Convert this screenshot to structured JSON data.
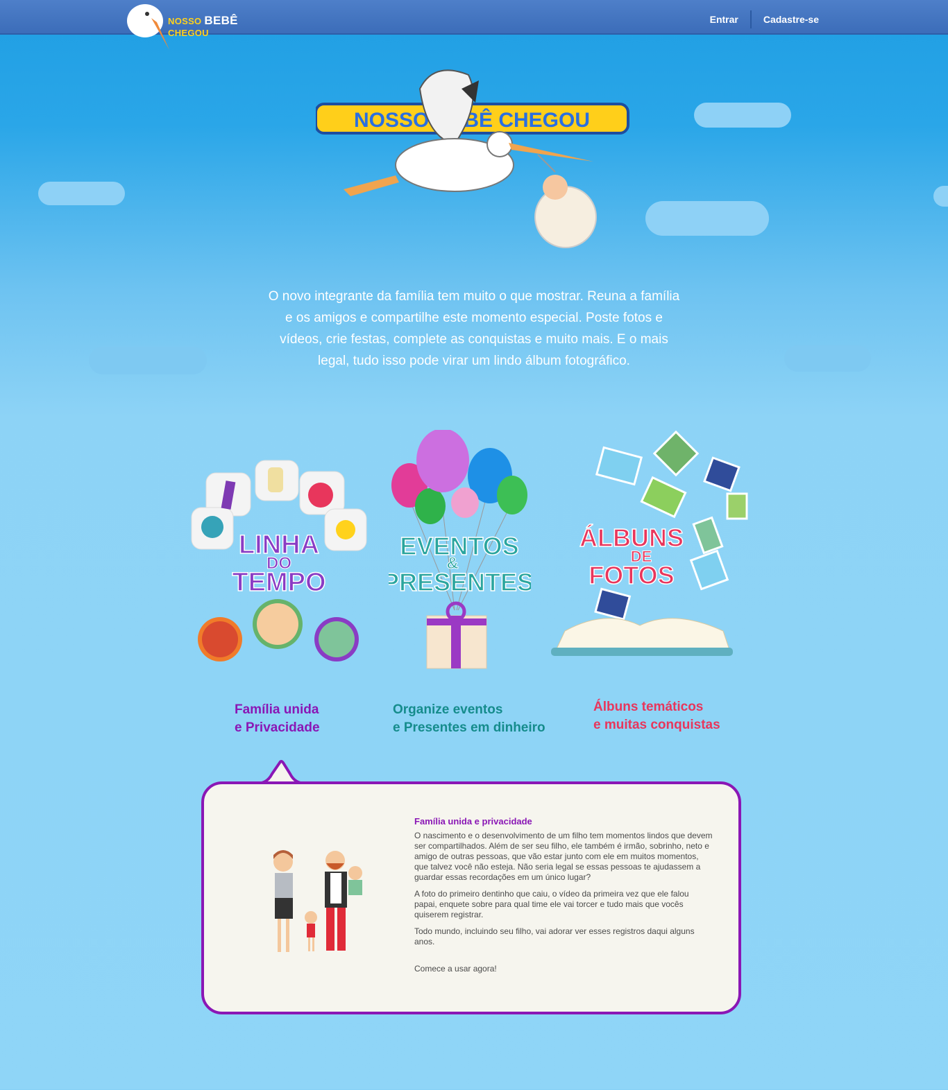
{
  "header": {
    "logo_small1": "NOSSO",
    "logo_big": "BEBÊ",
    "logo_small2": "CHEGOU",
    "nav_login": "Entrar",
    "nav_signup": "Cadastre-se"
  },
  "hero": {
    "banner_text": "NOSSO BEBÊ CHEGOU"
  },
  "intro": {
    "text": "O novo integrante da família tem muito o que mostrar. Reuna a família e os amigos e compartilhe este momento especial. Poste fotos e vídeos, crie festas, complete as conquistas e muito mais. E o mais legal, tudo isso pode virar um lindo álbum fotográfico."
  },
  "features": [
    {
      "title_line1": "LINHA",
      "title_line2": "DO",
      "title_line3": "TEMPO",
      "caption_line1": "Família unida",
      "caption_line2": "e  Privacidade",
      "color": "#8a17b5"
    },
    {
      "title_line1": "EVENTOS",
      "title_line2": "&",
      "title_line3": "PRESENTES",
      "caption_line1": "Organize eventos",
      "caption_line2": "e Presentes em dinheiro",
      "color": "#158c8c"
    },
    {
      "title_line1": "ÁLBUNS",
      "title_line2": "DE",
      "title_line3": "FOTOS",
      "caption_line1": "Álbuns temáticos",
      "caption_line2": "e muitas conquistas",
      "color": "#e8365c"
    }
  ],
  "panel": {
    "heading": "Família unida e privacidade",
    "p1": "O nascimento e o desenvolvimento de um filho tem momentos lindos que devem ser compartilhados. Além de ser seu filho, ele também é irmão, sobrinho, neto e amigo de outras pessoas, que vão estar junto com ele em muitos momentos, que talvez você não esteja. Não seria legal se essas pessoas te ajudassem a guardar essas recordações em um único lugar?",
    "p2": "A foto do primeiro dentinho que caiu, o vídeo da primeira vez que ele falou papai, enquete sobre para qual time ele vai torcer e tudo mais que vocês quiserem registrar.",
    "p3": "Todo mundo, incluindo seu filho, vai adorar ver esses registros daqui alguns anos.",
    "cta": "Comece a usar agora!",
    "border_color": "#8a17b5"
  }
}
